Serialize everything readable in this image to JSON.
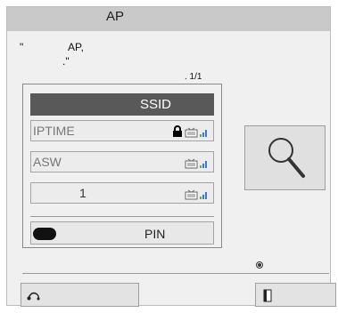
{
  "dialog": {
    "title": "AP",
    "message_line1_quote": "\"",
    "message_line1_text": "AP,",
    "message_line2": ".\"",
    "page_indicator": ". 1/1"
  },
  "network_list": {
    "header_label": "SSID",
    "items": [
      {
        "ssid": "IPTIME",
        "secured": true,
        "icon": "wifi-signal-icon"
      },
      {
        "ssid": "ASW",
        "secured": false,
        "icon": "wifi-signal-icon"
      },
      {
        "ssid": "1",
        "secured": false,
        "icon": "wifi-signal-icon"
      }
    ],
    "pin_button_label": "PIN"
  },
  "search_button": {
    "icon": "magnifier-icon"
  },
  "colors": {
    "header_bg": "#595959",
    "wifi_green": "#6aa84f",
    "wifi_blue": "#3c78d8"
  }
}
